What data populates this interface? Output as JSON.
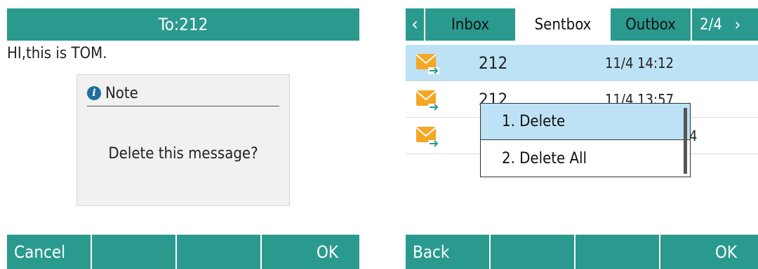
{
  "left_screen": {
    "title": "To:212",
    "message_body": "HI,this is TOM.",
    "dialog": {
      "title": "Note",
      "text": "Delete this message?"
    },
    "softkeys": [
      "Cancel",
      "",
      "",
      "OK"
    ]
  },
  "right_screen": {
    "tabs": [
      "Inbox",
      "Sentbox",
      "Outbox"
    ],
    "active_tab": "Sentbox",
    "page_indicator": "2/4",
    "messages": [
      {
        "number": "212",
        "time": "11/4 14:12",
        "selected": true
      },
      {
        "number": "212",
        "time": "11/4 13:57",
        "selected": false
      },
      {
        "number": "",
        "time": "4",
        "selected": false
      }
    ],
    "popup_menu": [
      "1. Delete",
      "2. Delete All"
    ],
    "softkeys": [
      "Back",
      "",
      "",
      "OK"
    ]
  },
  "colors": {
    "bar": "#2a9a8f",
    "highlight": "#bde2f5",
    "envelope": "#f5a623"
  }
}
